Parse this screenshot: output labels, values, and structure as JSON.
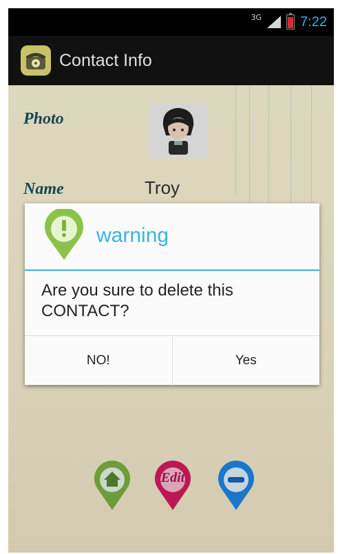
{
  "status_bar": {
    "network": "3G",
    "time": "7:22"
  },
  "action_bar": {
    "title": "Contact Info",
    "icon": "telephone-icon"
  },
  "contact": {
    "photo_label": "Photo",
    "name_label": "Name",
    "name_value": "Troy"
  },
  "dialog": {
    "title": "warning",
    "icon": "warning-pin-icon",
    "message": "Are you sure to delete this CONTACT?",
    "no_label": "NO!",
    "yes_label": "Yes"
  },
  "bottom_actions": {
    "edit_label": "Edit",
    "home_icon": "home-icon",
    "delete_icon": "minus-icon"
  },
  "colors": {
    "accent": "#33b5e5",
    "title_bar": "#111111",
    "label": "#1c4e5c"
  }
}
